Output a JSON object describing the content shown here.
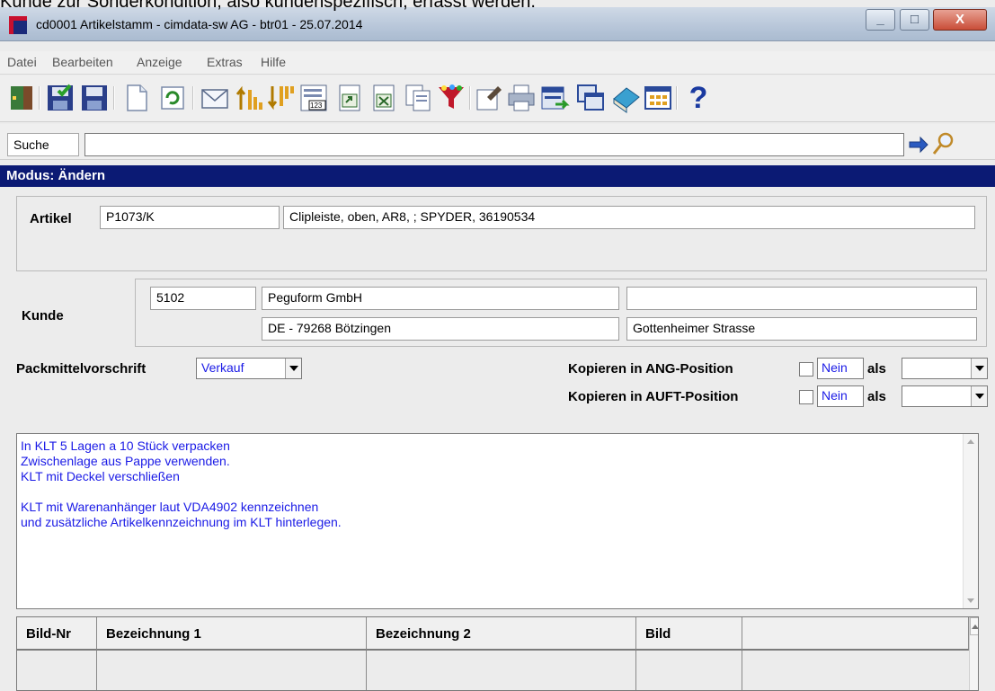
{
  "page": {
    "caption_fragment": "Kunde zur Sonderkondition, also kundenspezifisch, erfasst werden."
  },
  "window": {
    "title": "cd0001 Artikelstamm - cimdata-sw AG - btr01 - 25.07.2014",
    "close_glyph": "X"
  },
  "menu": [
    {
      "label": "Datei"
    },
    {
      "label": "Bearbeiten"
    },
    {
      "label": "Anzeige"
    },
    {
      "label": "Extras"
    },
    {
      "label": "Hilfe"
    }
  ],
  "toolbar": {
    "icons": [
      "exit-icon",
      "save-close-icon",
      "save-icon",
      "new-document-icon",
      "refresh-icon",
      "mail-icon",
      "sort-ascending-icon",
      "sort-descending-icon",
      "number-format-icon",
      "export-icon",
      "excel-icon",
      "copy-document-icon",
      "filter-icon",
      "properties-icon",
      "print-icon",
      "transfer-icon",
      "windows-icon",
      "book-icon",
      "grid-view-icon",
      "help-icon"
    ],
    "help_glyph": "?"
  },
  "search": {
    "label": "Suche",
    "value": ""
  },
  "mode": {
    "text": "Modus: Ändern"
  },
  "artikel": {
    "label": "Artikel",
    "number": "P1073/K",
    "description": "Clipleiste, oben, AR8, ; SPYDER, 36190534"
  },
  "kunde": {
    "label": "Kunde",
    "number": "5102",
    "name": "Peguform GmbH",
    "extra": "",
    "city": "DE - 79268 Bötzingen",
    "street": "Gottenheimer Strasse"
  },
  "packmittel": {
    "label": "Packmittelvorschrift",
    "value": "Verkauf"
  },
  "kopieren": [
    {
      "label": "Kopieren in ANG-Position",
      "check_value": "Nein",
      "als_label": "als",
      "als_value": ""
    },
    {
      "label": "Kopieren in AUFT-Position",
      "check_value": "Nein",
      "als_label": "als",
      "als_value": ""
    }
  ],
  "memo": {
    "lines": [
      "In KLT 5 Lagen a 10 Stück verpacken",
      "Zwischenlage aus Pappe verwenden.",
      "KLT mit Deckel verschließen",
      "",
      "KLT mit Warenanhänger laut VDA4902 kennzeichnen",
      "und zusätzliche Artikelkennzeichnung im KLT hinterlegen."
    ]
  },
  "grid": {
    "columns": [
      "Bild-Nr",
      "Bezeichnung 1",
      "Bezeichnung 2",
      "Bild",
      ""
    ]
  },
  "colors": {
    "mode_bar": "#0b1a74",
    "memo_text": "#1a1ae6",
    "title_bar": "#b7c6d9"
  }
}
